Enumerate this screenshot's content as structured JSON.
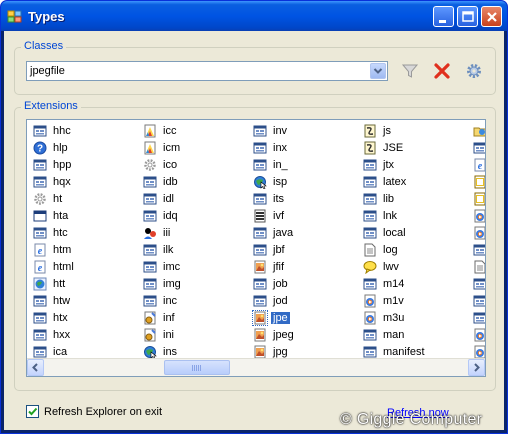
{
  "window": {
    "title": "Types"
  },
  "classes": {
    "group_label": "Classes",
    "selected_value": "jpegfile"
  },
  "extensions": {
    "group_label": "Extensions",
    "columns": [
      [
        {
          "label": "hhc",
          "icon": "window-app-icon"
        },
        {
          "label": "hlp",
          "icon": "help-icon"
        },
        {
          "label": "hpp",
          "icon": "window-app-icon"
        },
        {
          "label": "hqx",
          "icon": "window-app-icon"
        },
        {
          "label": "ht",
          "icon": "gear-icon"
        },
        {
          "label": "hta",
          "icon": "window-frame-icon"
        },
        {
          "label": "htc",
          "icon": "window-app-icon"
        },
        {
          "label": "htm",
          "icon": "ie-document-icon"
        },
        {
          "label": "html",
          "icon": "ie-document-icon"
        },
        {
          "label": "htt",
          "icon": "globe-icon"
        },
        {
          "label": "htw",
          "icon": "window-app-icon"
        },
        {
          "label": "htx",
          "icon": "window-app-icon"
        },
        {
          "label": "hxx",
          "icon": "window-app-icon"
        },
        {
          "label": "ica",
          "icon": "window-app-icon"
        }
      ],
      [
        {
          "label": "icc",
          "icon": "color-profile-icon"
        },
        {
          "label": "icm",
          "icon": "color-profile-icon"
        },
        {
          "label": "ico",
          "icon": "gear-icon"
        },
        {
          "label": "idb",
          "icon": "window-app-icon"
        },
        {
          "label": "idl",
          "icon": "window-app-icon"
        },
        {
          "label": "idq",
          "icon": "window-app-icon"
        },
        {
          "label": "iii",
          "icon": "chat-users-icon"
        },
        {
          "label": "ilk",
          "icon": "window-app-icon"
        },
        {
          "label": "imc",
          "icon": "window-app-icon"
        },
        {
          "label": "img",
          "icon": "window-app-icon"
        },
        {
          "label": "inc",
          "icon": "window-app-icon"
        },
        {
          "label": "inf",
          "icon": "settings-file-icon"
        },
        {
          "label": "ini",
          "icon": "settings-file-icon"
        },
        {
          "label": "ins",
          "icon": "globe-cursor-icon"
        }
      ],
      [
        {
          "label": "inv",
          "icon": "window-app-icon"
        },
        {
          "label": "inx",
          "icon": "window-app-icon"
        },
        {
          "label": "in_",
          "icon": "window-app-icon"
        },
        {
          "label": "isp",
          "icon": "globe-cursor-icon"
        },
        {
          "label": "its",
          "icon": "window-app-icon"
        },
        {
          "label": "ivf",
          "icon": "video-file-icon"
        },
        {
          "label": "java",
          "icon": "window-app-icon"
        },
        {
          "label": "jbf",
          "icon": "window-app-icon"
        },
        {
          "label": "jfif",
          "icon": "image-file-icon"
        },
        {
          "label": "job",
          "icon": "window-app-icon"
        },
        {
          "label": "jod",
          "icon": "window-app-icon"
        },
        {
          "label": "jpe",
          "icon": "image-file-icon",
          "selected": true
        },
        {
          "label": "jpeg",
          "icon": "image-file-icon"
        },
        {
          "label": "jpg",
          "icon": "image-file-icon"
        }
      ],
      [
        {
          "label": "js",
          "icon": "script-file-icon"
        },
        {
          "label": "JSE",
          "icon": "script-file-icon"
        },
        {
          "label": "jtx",
          "icon": "window-app-icon"
        },
        {
          "label": "latex",
          "icon": "window-app-icon"
        },
        {
          "label": "lib",
          "icon": "window-app-icon"
        },
        {
          "label": "lnk",
          "icon": "window-app-icon"
        },
        {
          "label": "local",
          "icon": "window-app-icon"
        },
        {
          "label": "log",
          "icon": "text-file-icon"
        },
        {
          "label": "lwv",
          "icon": "speech-bubble-icon"
        },
        {
          "label": "m14",
          "icon": "window-app-icon"
        },
        {
          "label": "m1v",
          "icon": "media-file-icon"
        },
        {
          "label": "m3u",
          "icon": "media-file-icon"
        },
        {
          "label": "man",
          "icon": "window-app-icon"
        },
        {
          "label": "manifest",
          "icon": "window-app-icon"
        }
      ],
      [
        {
          "label": "",
          "icon": "folder-globe-icon"
        },
        {
          "label": "",
          "icon": "window-app-icon"
        },
        {
          "label": "",
          "icon": "ie-document-icon"
        },
        {
          "label": "",
          "icon": "film-file-icon"
        },
        {
          "label": "",
          "icon": "film-file-icon"
        },
        {
          "label": "",
          "icon": "media-file-icon"
        },
        {
          "label": "",
          "icon": "media-file-icon"
        },
        {
          "label": "",
          "icon": "window-app-icon"
        },
        {
          "label": "",
          "icon": "text-file-icon"
        },
        {
          "label": "",
          "icon": "window-app-icon"
        },
        {
          "label": "",
          "icon": "window-app-icon"
        },
        {
          "label": "",
          "icon": "window-app-icon"
        },
        {
          "label": "",
          "icon": "media-file-icon"
        },
        {
          "label": "",
          "icon": "media-file-icon"
        }
      ]
    ]
  },
  "footer": {
    "refresh_checkbox_label": "Refresh Explorer on exit",
    "refresh_checked": true,
    "refresh_link": "Refresh now"
  },
  "watermark": "© Giggle Computer"
}
